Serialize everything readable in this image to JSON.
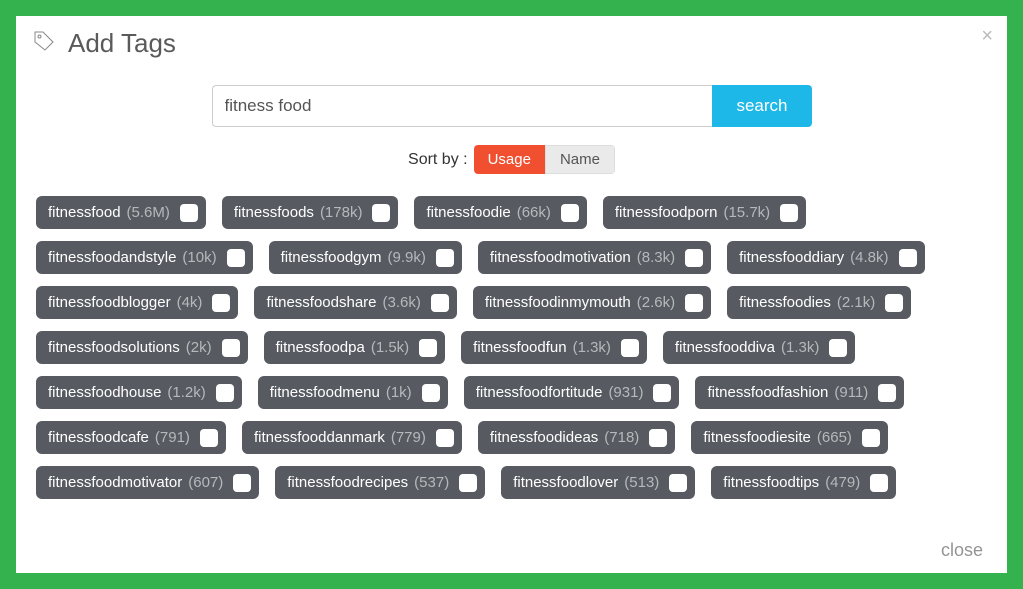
{
  "header": {
    "title": "Add Tags"
  },
  "search": {
    "value": "fitness food",
    "button": "search"
  },
  "sort": {
    "label": "Sort by :",
    "usage": "Usage",
    "name": "Name"
  },
  "footer": {
    "close": "close"
  },
  "tags": [
    {
      "name": "fitnessfood",
      "count": "5.6M"
    },
    {
      "name": "fitnessfoods",
      "count": "178k"
    },
    {
      "name": "fitnessfoodie",
      "count": "66k"
    },
    {
      "name": "fitnessfoodporn",
      "count": "15.7k"
    },
    {
      "name": "fitnessfoodandstyle",
      "count": "10k"
    },
    {
      "name": "fitnessfoodgym",
      "count": "9.9k"
    },
    {
      "name": "fitnessfoodmotivation",
      "count": "8.3k"
    },
    {
      "name": "fitnessfooddiary",
      "count": "4.8k"
    },
    {
      "name": "fitnessfoodblogger",
      "count": "4k"
    },
    {
      "name": "fitnessfoodshare",
      "count": "3.6k"
    },
    {
      "name": "fitnessfoodinmymouth",
      "count": "2.6k"
    },
    {
      "name": "fitnessfoodies",
      "count": "2.1k"
    },
    {
      "name": "fitnessfoodsolutions",
      "count": "2k"
    },
    {
      "name": "fitnessfoodpa",
      "count": "1.5k"
    },
    {
      "name": "fitnessfoodfun",
      "count": "1.3k"
    },
    {
      "name": "fitnessfooddiva",
      "count": "1.3k"
    },
    {
      "name": "fitnessfoodhouse",
      "count": "1.2k"
    },
    {
      "name": "fitnessfoodmenu",
      "count": "1k"
    },
    {
      "name": "fitnessfoodfortitude",
      "count": "931"
    },
    {
      "name": "fitnessfoodfashion",
      "count": "911"
    },
    {
      "name": "fitnessfoodcafe",
      "count": "791"
    },
    {
      "name": "fitnessfooddanmark",
      "count": "779"
    },
    {
      "name": "fitnessfoodideas",
      "count": "718"
    },
    {
      "name": "fitnessfoodiesite",
      "count": "665"
    },
    {
      "name": "fitnessfoodmotivator",
      "count": "607"
    },
    {
      "name": "fitnessfoodrecipes",
      "count": "537"
    },
    {
      "name": "fitnessfoodlover",
      "count": "513"
    },
    {
      "name": "fitnessfoodtips",
      "count": "479"
    }
  ]
}
